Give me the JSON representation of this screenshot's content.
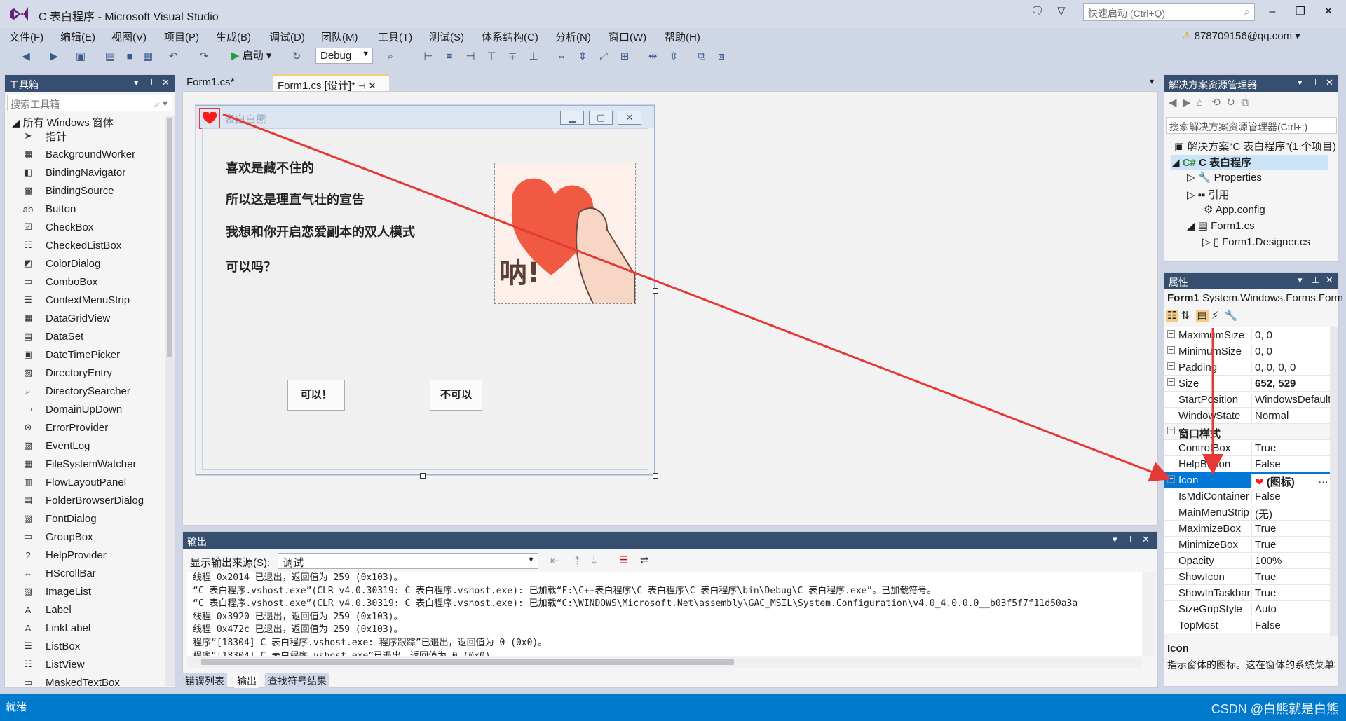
{
  "window": {
    "title": "C 表白程序 - Microsoft Visual Studio"
  },
  "quick_launch": {
    "placeholder": "快速启动 (Ctrl+Q)"
  },
  "menu": [
    "文件(F)",
    "编辑(E)",
    "视图(V)",
    "项目(P)",
    "生成(B)",
    "调试(D)",
    "团队(M)",
    "工具(T)",
    "测试(S)",
    "体系结构(C)",
    "分析(N)",
    "窗口(W)",
    "帮助(H)"
  ],
  "account": {
    "name": "878709156@qq.com"
  },
  "toolbar": {
    "start_label": "启动",
    "config": "Debug"
  },
  "toolbox": {
    "title": "工具箱",
    "search_placeholder": "搜索工具箱",
    "group": "所有 Windows 窗体",
    "items": [
      "指针",
      "BackgroundWorker",
      "BindingNavigator",
      "BindingSource",
      "Button",
      "CheckBox",
      "CheckedListBox",
      "ColorDialog",
      "ComboBox",
      "ContextMenuStrip",
      "DataGridView",
      "DataSet",
      "DateTimePicker",
      "DirectoryEntry",
      "DirectorySearcher",
      "DomainUpDown",
      "ErrorProvider",
      "EventLog",
      "FileSystemWatcher",
      "FlowLayoutPanel",
      "FolderBrowserDialog",
      "FontDialog",
      "GroupBox",
      "HelpProvider",
      "HScrollBar",
      "ImageList",
      "Label",
      "LinkLabel",
      "ListBox",
      "ListView",
      "MaskedTextBox"
    ]
  },
  "doc_tabs": [
    "Form1.cs*",
    "Form1.cs [设计]*"
  ],
  "form": {
    "caption": "表白白熊",
    "lines": [
      "喜欢是藏不住的",
      "所以这是理直气壮的宣告",
      "我想和你开启恋爱副本的双人模式",
      "可以吗？"
    ],
    "picture_text": "呐!",
    "btn_yes": "可以！",
    "btn_no": "不可以"
  },
  "output": {
    "title": "输出",
    "source_label": "显示输出来源(S):",
    "source_value": "调试",
    "lines": [
      "线程 0x2014 已退出，返回值为 259 (0x103)。",
      "“C 表白程序.vshost.exe”(CLR v4.0.30319: C 表白程序.vshost.exe): 已加载“F:\\C++表白程序\\C 表白程序\\C 表白程序\\bin\\Debug\\C 表白程序.exe”。已加载符号。",
      "“C 表白程序.vshost.exe”(CLR v4.0.30319: C 表白程序.vshost.exe): 已加载“C:\\WINDOWS\\Microsoft.Net\\assembly\\GAC_MSIL\\System.Configuration\\v4.0_4.0.0.0__b03f5f7f11d50a3a",
      "线程 0x3920 已退出，返回值为 259 (0x103)。",
      "线程 0x472c 已退出，返回值为 259 (0x103)。",
      "程序“[18304] C 表白程序.vshost.exe: 程序跟踪”已退出，返回值为 0 (0x0)。",
      "程序“[18304] C 表白程序.vshost.exe”已退出，返回值为 0 (0x0)。"
    ]
  },
  "bottom_tabs": [
    "错误列表",
    "输出",
    "查找符号结果"
  ],
  "solution": {
    "title": "解决方案资源管理器",
    "search_placeholder": "搜索解决方案资源管理器(Ctrl+;)",
    "items": [
      "解决方案“C 表白程序”(1 个项目)",
      "C 表白程序",
      "Properties",
      "引用",
      "App.config",
      "Form1.cs",
      "Form1.Designer.cs"
    ]
  },
  "properties": {
    "title": "属性",
    "object": "Form1",
    "object_type": "System.Windows.Forms.Form",
    "rows": [
      {
        "name": "MaximumSize",
        "value": "0, 0",
        "expand": true
      },
      {
        "name": "MinimumSize",
        "value": "0, 0",
        "expand": true
      },
      {
        "name": "Padding",
        "value": "0, 0, 0, 0",
        "expand": true
      },
      {
        "name": "Size",
        "value": "652, 529",
        "expand": true,
        "bold": true
      },
      {
        "name": "StartPosition",
        "value": "WindowsDefaultLocation"
      },
      {
        "name": "WindowState",
        "value": "Normal"
      },
      {
        "name": "窗口样式",
        "value": "",
        "category": true
      },
      {
        "name": "ControlBox",
        "value": "True"
      },
      {
        "name": "HelpButton",
        "value": "False"
      },
      {
        "name": "Icon",
        "value": "(图标)",
        "expand": true,
        "selected": true
      },
      {
        "name": "IsMdiContainer",
        "value": "False"
      },
      {
        "name": "MainMenuStrip",
        "value": "(无)"
      },
      {
        "name": "MaximizeBox",
        "value": "True"
      },
      {
        "name": "MinimizeBox",
        "value": "True"
      },
      {
        "name": "Opacity",
        "value": "100%"
      },
      {
        "name": "ShowIcon",
        "value": "True"
      },
      {
        "name": "ShowInTaskbar",
        "value": "True"
      },
      {
        "name": "SizeGripStyle",
        "value": "Auto"
      },
      {
        "name": "TopMost",
        "value": "False"
      }
    ],
    "desc_name": "Icon",
    "desc_text": "指示窗体的图标。这在窗体的系统菜单框中显示"
  },
  "status": {
    "text": "就绪",
    "watermark": "CSDN @白熊就是白熊"
  },
  "colors": {
    "accent": "#007acc",
    "panel_header": "#364e6f",
    "annotation": "#e53935",
    "heart": "#ff1a1a"
  }
}
